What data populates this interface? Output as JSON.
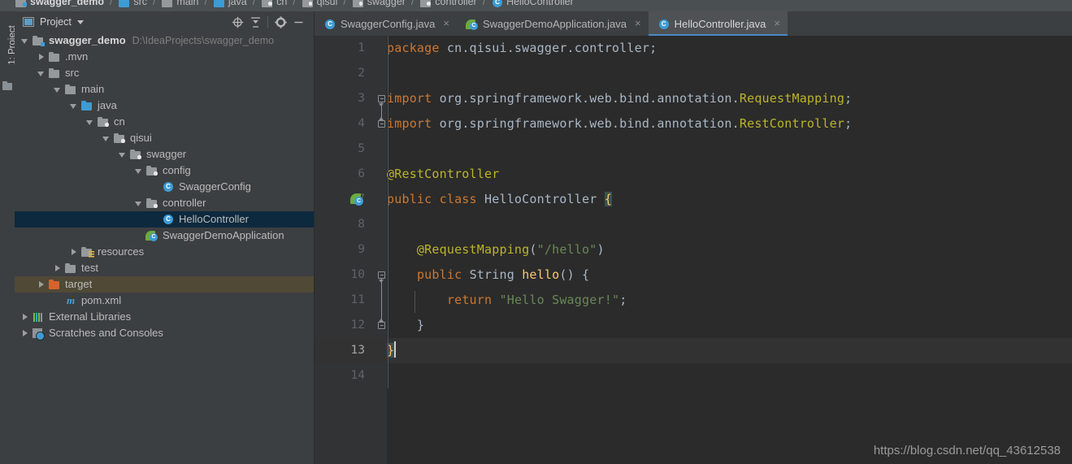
{
  "breadcrumb": {
    "items": [
      {
        "label": "swagger_demo",
        "icon": "module-folder-icon"
      },
      {
        "label": "src",
        "icon": "source-folder-icon"
      },
      {
        "label": "main",
        "icon": "folder-icon"
      },
      {
        "label": "java",
        "icon": "source-folder-icon"
      },
      {
        "label": "cn",
        "icon": "package-icon"
      },
      {
        "label": "qisui",
        "icon": "package-icon"
      },
      {
        "label": "swagger",
        "icon": "package-icon"
      },
      {
        "label": "controller",
        "icon": "package-icon"
      },
      {
        "label": "HelloController",
        "icon": "class-icon"
      }
    ],
    "separator": "/"
  },
  "tool_strip": {
    "label": "1: Project",
    "icon": "folder-icon"
  },
  "project_panel": {
    "title": "Project",
    "dropdown_icon": "chevron-down-icon",
    "panel_icon": "project-view-icon",
    "buttons": [
      {
        "name": "select-opened-file",
        "icon": "crosshair-icon"
      },
      {
        "name": "collapse-all",
        "icon": "collapse-all-icon"
      },
      {
        "name": "settings",
        "icon": "gear-icon"
      },
      {
        "name": "hide",
        "icon": "minimize-icon"
      }
    ],
    "tree": [
      {
        "label": "swagger_demo",
        "sub": "D:\\IdeaProjects\\swagger_demo",
        "depth": 0,
        "arrow": "down",
        "icon": "module-folder-icon",
        "bold": true,
        "state": "normal"
      },
      {
        "label": ".mvn",
        "sub": "",
        "depth": 1,
        "arrow": "right",
        "icon": "folder-icon",
        "bold": false,
        "state": "normal"
      },
      {
        "label": "src",
        "sub": "",
        "depth": 1,
        "arrow": "down",
        "icon": "folder-icon",
        "bold": false,
        "state": "normal"
      },
      {
        "label": "main",
        "sub": "",
        "depth": 2,
        "arrow": "down",
        "icon": "folder-icon",
        "bold": false,
        "state": "normal"
      },
      {
        "label": "java",
        "sub": "",
        "depth": 3,
        "arrow": "down",
        "icon": "source-folder-icon",
        "bold": false,
        "state": "normal"
      },
      {
        "label": "cn",
        "sub": "",
        "depth": 4,
        "arrow": "down",
        "icon": "package-icon",
        "bold": false,
        "state": "normal"
      },
      {
        "label": "qisui",
        "sub": "",
        "depth": 5,
        "arrow": "down",
        "icon": "package-icon",
        "bold": false,
        "state": "normal"
      },
      {
        "label": "swagger",
        "sub": "",
        "depth": 6,
        "arrow": "down",
        "icon": "package-icon",
        "bold": false,
        "state": "normal"
      },
      {
        "label": "config",
        "sub": "",
        "depth": 7,
        "arrow": "down",
        "icon": "package-icon",
        "bold": false,
        "state": "normal"
      },
      {
        "label": "SwaggerConfig",
        "sub": "",
        "depth": 8,
        "arrow": "none",
        "icon": "class-icon",
        "bold": false,
        "state": "normal"
      },
      {
        "label": "controller",
        "sub": "",
        "depth": 7,
        "arrow": "down",
        "icon": "package-icon",
        "bold": false,
        "state": "normal"
      },
      {
        "label": "HelloController",
        "sub": "",
        "depth": 8,
        "arrow": "none",
        "icon": "class-icon",
        "bold": false,
        "state": "selected"
      },
      {
        "label": "SwaggerDemoApplication",
        "sub": "",
        "depth": 7,
        "arrow": "none",
        "icon": "spring-class-icon",
        "bold": false,
        "state": "normal"
      },
      {
        "label": "resources",
        "sub": "",
        "depth": 3,
        "arrow": "right",
        "icon": "resources-folder-icon",
        "bold": false,
        "state": "normal"
      },
      {
        "label": "test",
        "sub": "",
        "depth": 2,
        "arrow": "right",
        "icon": "folder-icon",
        "bold": false,
        "state": "normal"
      },
      {
        "label": "target",
        "sub": "",
        "depth": 1,
        "arrow": "right",
        "icon": "excluded-folder-icon",
        "bold": false,
        "state": "excluded"
      },
      {
        "label": "pom.xml",
        "sub": "",
        "depth": 2,
        "arrow": "none",
        "icon": "maven-icon",
        "bold": false,
        "state": "normal"
      },
      {
        "label": "External Libraries",
        "sub": "",
        "depth": 0,
        "arrow": "right",
        "icon": "libraries-icon",
        "bold": false,
        "state": "normal"
      },
      {
        "label": "Scratches and Consoles",
        "sub": "",
        "depth": 0,
        "arrow": "right",
        "icon": "scratches-icon",
        "bold": false,
        "state": "normal"
      }
    ]
  },
  "editor": {
    "tabs": [
      {
        "label": "SwaggerConfig.java",
        "icon": "class-icon",
        "active": false,
        "close_icon": "×"
      },
      {
        "label": "SwaggerDemoApplication.java",
        "icon": "spring-class-icon",
        "active": false,
        "close_icon": "×"
      },
      {
        "label": "HelloController.java",
        "icon": "class-icon",
        "active": true,
        "close_icon": "×"
      }
    ],
    "current_line": 13,
    "lines": [
      {
        "num": "1",
        "tokens": [
          {
            "t": "package ",
            "c": "kw"
          },
          {
            "t": "cn.qisui.swagger.controller;",
            "c": "pl"
          }
        ]
      },
      {
        "num": "2",
        "tokens": []
      },
      {
        "num": "3",
        "tokens": [
          {
            "t": "import ",
            "c": "kw"
          },
          {
            "t": "org.springframework.web.bind.annotation.",
            "c": "pl"
          },
          {
            "t": "RequestMapping",
            "c": "ann"
          },
          {
            "t": ";",
            "c": "pl"
          }
        ]
      },
      {
        "num": "4",
        "tokens": [
          {
            "t": "import ",
            "c": "kw"
          },
          {
            "t": "org.springframework.web.bind.annotation.",
            "c": "pl"
          },
          {
            "t": "RestController",
            "c": "ann"
          },
          {
            "t": ";",
            "c": "pl"
          }
        ]
      },
      {
        "num": "5",
        "tokens": []
      },
      {
        "num": "6",
        "tokens": [
          {
            "t": "@RestController",
            "c": "ann"
          }
        ]
      },
      {
        "num": "7",
        "tokens": [
          {
            "t": "public class ",
            "c": "kw"
          },
          {
            "t": "HelloController ",
            "c": "pl"
          },
          {
            "t": "{",
            "c": "brace-hl"
          }
        ]
      },
      {
        "num": "8",
        "tokens": []
      },
      {
        "num": "9",
        "tokens": [
          {
            "t": "    @RequestMapping",
            "c": "ann"
          },
          {
            "t": "(",
            "c": "pl"
          },
          {
            "t": "\"/hello\"",
            "c": "str"
          },
          {
            "t": ")",
            "c": "pl"
          }
        ]
      },
      {
        "num": "10",
        "tokens": [
          {
            "t": "    ",
            "c": "pl"
          },
          {
            "t": "public ",
            "c": "kw"
          },
          {
            "t": "String ",
            "c": "pl"
          },
          {
            "t": "hello",
            "c": "fn"
          },
          {
            "t": "() {",
            "c": "pl"
          }
        ]
      },
      {
        "num": "11",
        "tokens": [
          {
            "t": "        ",
            "c": "pl"
          },
          {
            "t": "return ",
            "c": "kw"
          },
          {
            "t": "\"Hello Swagger!\"",
            "c": "str"
          },
          {
            "t": ";",
            "c": "pl"
          }
        ]
      },
      {
        "num": "12",
        "tokens": [
          {
            "t": "    }",
            "c": "pl"
          }
        ]
      },
      {
        "num": "13",
        "tokens": [
          {
            "t": "}",
            "c": "brace-hl"
          }
        ]
      },
      {
        "num": "14",
        "tokens": []
      }
    ],
    "gutter_icons": [
      {
        "line": 7,
        "icon": "spring-bean-icon"
      }
    ]
  },
  "watermark": {
    "text": "https://blog.csdn.net/qq_43612538"
  },
  "colors": {
    "panel_bg": "#3c3f41",
    "editor_bg": "#2b2b2b",
    "gutter_bg": "#313335",
    "selection": "#0d293e",
    "excluded": "#4f4936",
    "accent": "#4a88c7",
    "keyword": "#cc7832",
    "string": "#6a8759",
    "annotation": "#bbb529",
    "method": "#ffc66d",
    "text": "#a9b7c6"
  }
}
